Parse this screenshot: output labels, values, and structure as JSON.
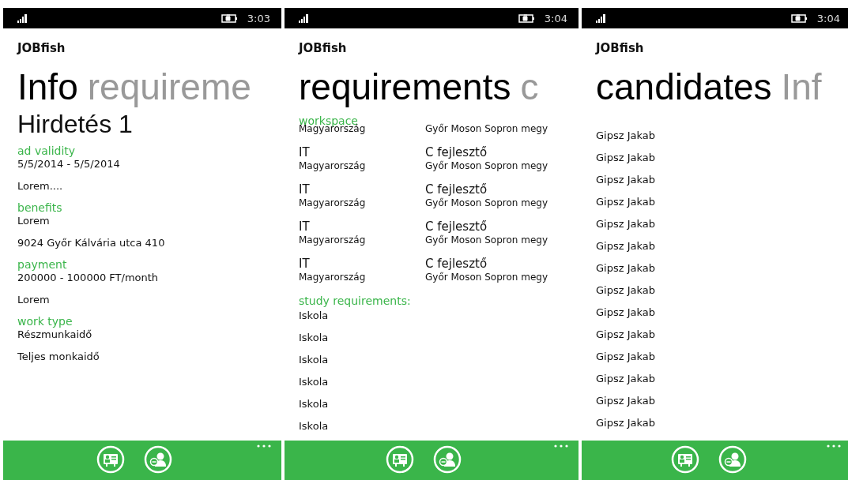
{
  "phones": [
    {
      "status": {
        "time": "3:03"
      },
      "app_title": "JOBfish",
      "pivot": [
        {
          "label": "Info",
          "selected": true
        },
        {
          "label": "requireme",
          "selected": false
        }
      ],
      "content": [
        {
          "kind": "heading",
          "text": "Hirdetés 1"
        },
        {
          "kind": "label",
          "text": "ad validity"
        },
        {
          "kind": "text",
          "text": "5/5/2014 - 5/5/2014"
        },
        {
          "kind": "text",
          "text": "Lorem...."
        },
        {
          "kind": "label",
          "text": "benefits"
        },
        {
          "kind": "text",
          "text": "Lorem"
        },
        {
          "kind": "text",
          "text": "9024 Győr Kálvária utca 410"
        },
        {
          "kind": "label",
          "text": "payment"
        },
        {
          "kind": "text",
          "text": "200000 - 100000 FT/month"
        },
        {
          "kind": "text",
          "text": "Lorem"
        },
        {
          "kind": "label",
          "text": "work type"
        },
        {
          "kind": "text",
          "text": "Részmunkaidő"
        },
        {
          "kind": "text",
          "text": "Teljes monkaidő"
        }
      ],
      "appbar": {
        "icons": [
          {
            "kind": "card"
          },
          {
            "kind": "remove-person"
          }
        ]
      }
    },
    {
      "status": {
        "time": "3:04"
      },
      "app_title": "JOBfish",
      "pivot": [
        {
          "label": "requirements",
          "selected": true
        },
        {
          "label": "c",
          "selected": false
        }
      ],
      "content": [
        {
          "kind": "label",
          "text": "workspace"
        },
        {
          "kind": "pair",
          "left": {
            "sub": "Magyarország"
          },
          "right": {
            "sub": "Győr Moson Sopron megy"
          }
        },
        {
          "kind": "pair",
          "left": {
            "title": "IT",
            "sub": "Magyarország"
          },
          "right": {
            "title": "C fejlesztő",
            "sub": "Győr Moson Sopron megy"
          }
        },
        {
          "kind": "pair",
          "left": {
            "title": "IT",
            "sub": "Magyarország"
          },
          "right": {
            "title": "C fejlesztő",
            "sub": "Győr Moson Sopron megy"
          }
        },
        {
          "kind": "pair",
          "left": {
            "title": "IT",
            "sub": "Magyarország"
          },
          "right": {
            "title": "C fejlesztő",
            "sub": "Győr Moson Sopron megy"
          }
        },
        {
          "kind": "pair",
          "left": {
            "title": "IT",
            "sub": "Magyarország"
          },
          "right": {
            "title": "C fejlesztő",
            "sub": "Győr Moson Sopron megy"
          }
        },
        {
          "kind": "label",
          "text": "study requirements:"
        },
        {
          "kind": "item",
          "text": "Iskola"
        },
        {
          "kind": "item",
          "text": "Iskola"
        },
        {
          "kind": "item",
          "text": "Iskola"
        },
        {
          "kind": "item",
          "text": "Iskola"
        },
        {
          "kind": "item",
          "text": "Iskola"
        },
        {
          "kind": "item",
          "text": "Iskola"
        }
      ],
      "appbar": {
        "icons": [
          {
            "kind": "card"
          },
          {
            "kind": "remove-person"
          }
        ]
      }
    },
    {
      "status": {
        "time": "3:04"
      },
      "app_title": "JOBfish",
      "pivot": [
        {
          "label": "candidates",
          "selected": true
        },
        {
          "label": "Inf",
          "selected": false
        }
      ],
      "content": [
        {
          "kind": "spacer"
        },
        {
          "kind": "item",
          "text": "Gipsz Jakab"
        },
        {
          "kind": "item",
          "text": "Gipsz Jakab"
        },
        {
          "kind": "item",
          "text": "Gipsz Jakab"
        },
        {
          "kind": "item",
          "text": "Gipsz Jakab"
        },
        {
          "kind": "item",
          "text": "Gipsz Jakab"
        },
        {
          "kind": "item",
          "text": "Gipsz Jakab"
        },
        {
          "kind": "item",
          "text": "Gipsz Jakab"
        },
        {
          "kind": "item",
          "text": "Gipsz Jakab"
        },
        {
          "kind": "item",
          "text": "Gipsz Jakab"
        },
        {
          "kind": "item",
          "text": "Gipsz Jakab"
        },
        {
          "kind": "item",
          "text": "Gipsz Jakab"
        },
        {
          "kind": "item",
          "text": "Gipsz Jakab"
        },
        {
          "kind": "item",
          "text": "Gipsz Jakab"
        },
        {
          "kind": "item",
          "text": "Gipsz Jakab"
        }
      ],
      "appbar": {
        "icons": [
          {
            "kind": "card"
          },
          {
            "kind": "remove-person"
          }
        ]
      }
    }
  ]
}
